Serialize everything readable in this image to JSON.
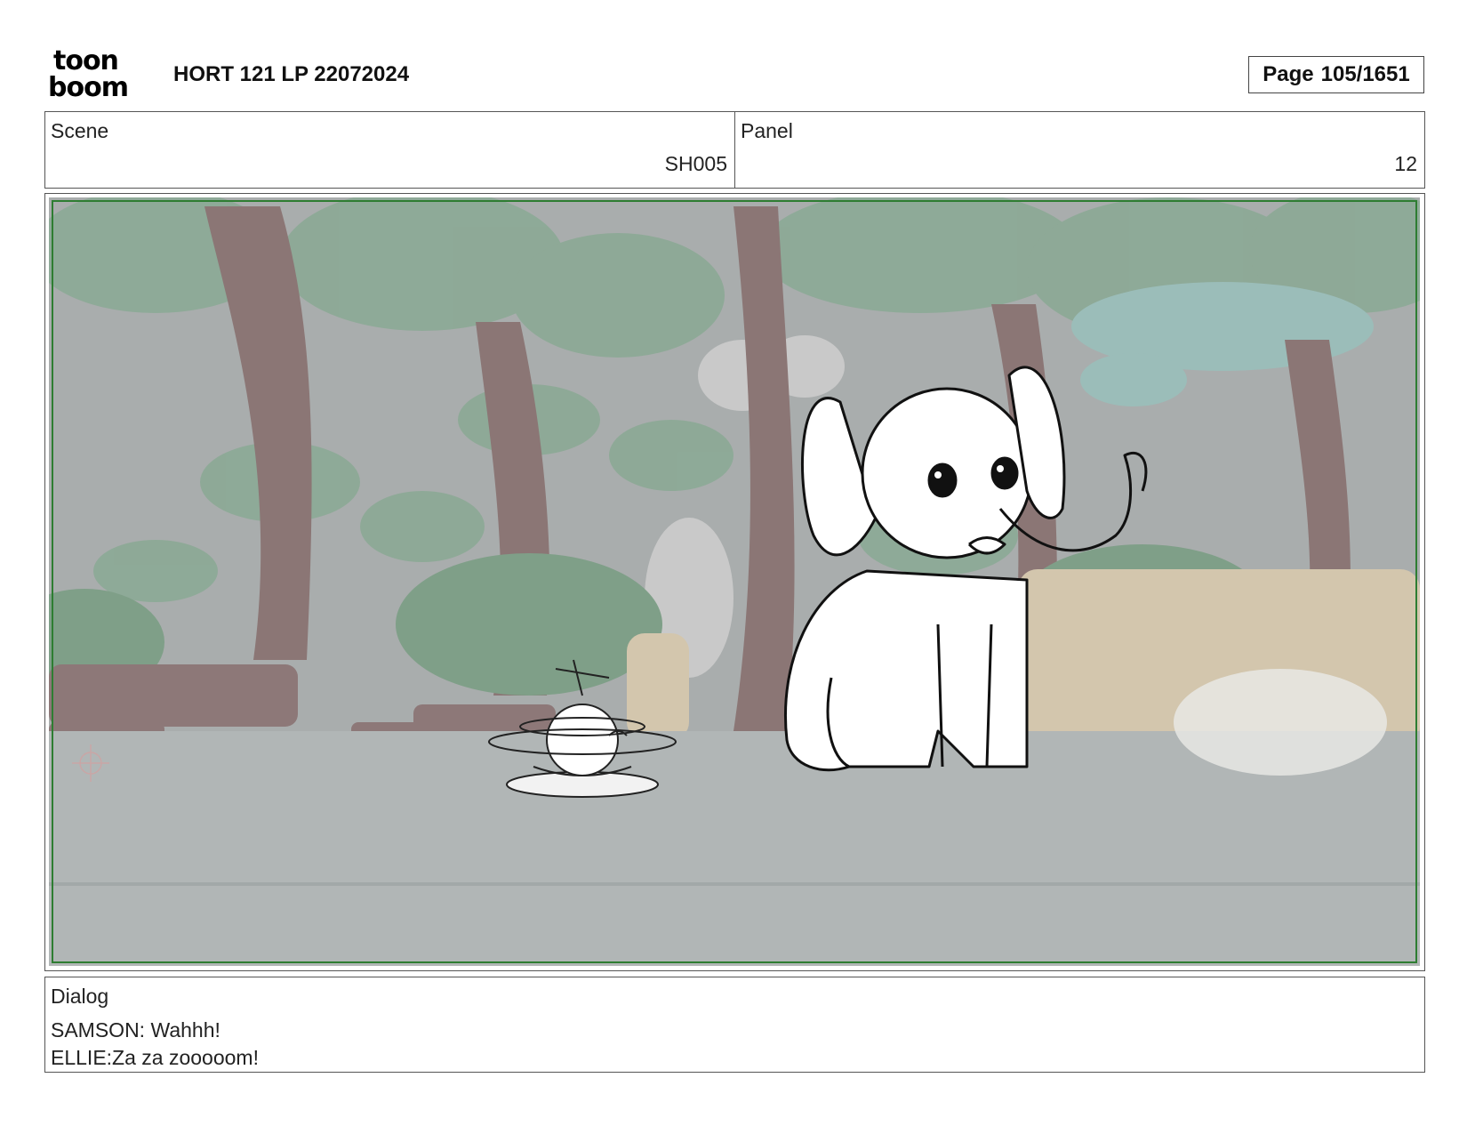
{
  "header": {
    "logo_line1": "toon",
    "logo_line2": "boom",
    "title": "HORT 121 LP 22072024",
    "page_label": "Page",
    "page_value": "105/1651"
  },
  "info": {
    "scene_label": "Scene",
    "scene_value": "SH005",
    "panel_label": "Panel",
    "panel_value": "12"
  },
  "panel": {
    "frame_color": "#2e7d32",
    "background_tone": "#b7bcbd",
    "foliage_color": "#8fb39a"
  },
  "dialog": {
    "label": "Dialog",
    "lines": [
      "SAMSON: Wahhh!",
      "ELLIE:Za za zooooom!"
    ]
  }
}
